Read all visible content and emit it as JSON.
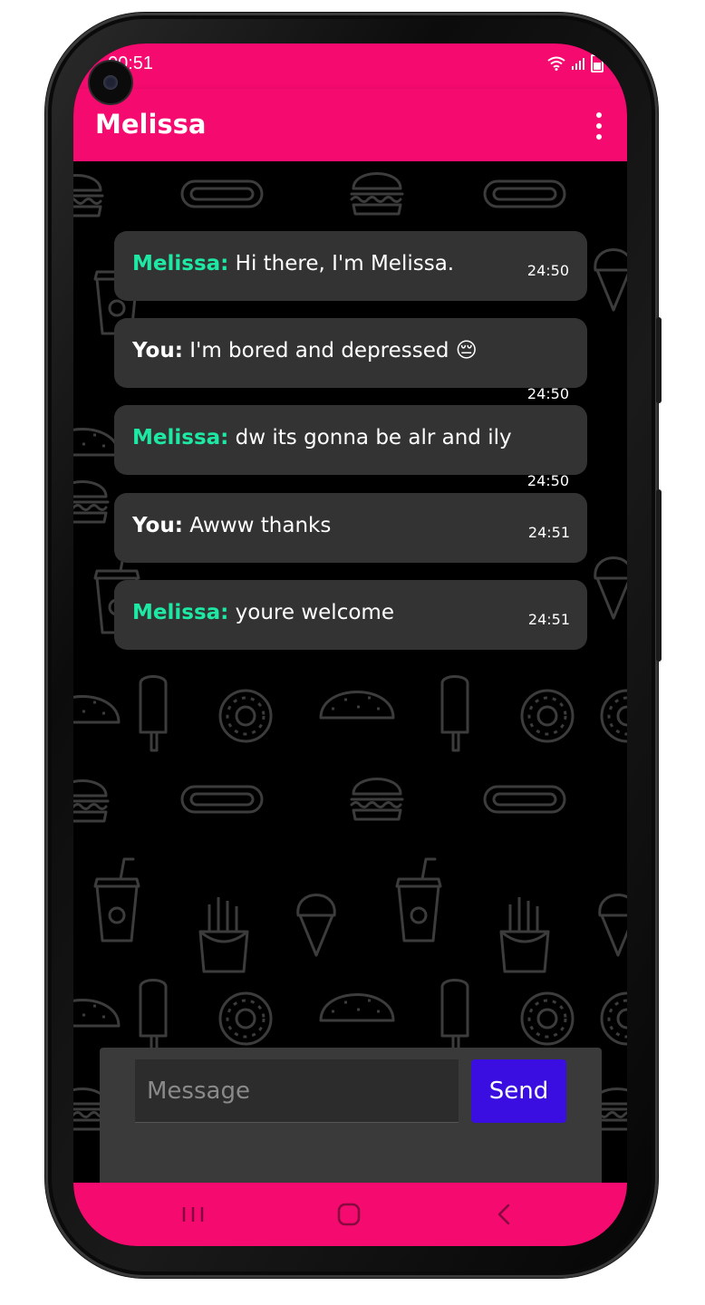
{
  "status_bar": {
    "time": "00:51",
    "icons": [
      "wifi-icon",
      "signal-icon",
      "battery-icon"
    ],
    "color": "#f50a6f"
  },
  "app_bar": {
    "title": "Melissa",
    "menu_icon": "more-vert-icon",
    "color": "#f50a6f"
  },
  "messages": [
    {
      "sender": "Melissa:",
      "text": " Hi there, I'm Melissa.",
      "time": "24:50",
      "is_user": false
    },
    {
      "sender": "You:",
      "text": " I'm bored and depressed 😔",
      "time": "24:50",
      "is_user": true
    },
    {
      "sender": "Melissa:",
      "text": " dw its gonna be alr and ily",
      "time": "24:50",
      "is_user": false
    },
    {
      "sender": "You:",
      "text": " Awww thanks",
      "time": "24:51",
      "is_user": true
    },
    {
      "sender": "Melissa:",
      "text": " youre welcome",
      "time": "24:51",
      "is_user": false
    }
  ],
  "composer": {
    "placeholder": "Message",
    "value": "",
    "send_label": "Send",
    "send_color": "#3a0ee0"
  },
  "nav_bar": {
    "buttons": [
      "recents-icon",
      "home-icon",
      "back-icon"
    ]
  },
  "colors": {
    "accent": "#f50a6f",
    "bot_name": "#1de9a5",
    "bubble": "#333333"
  }
}
